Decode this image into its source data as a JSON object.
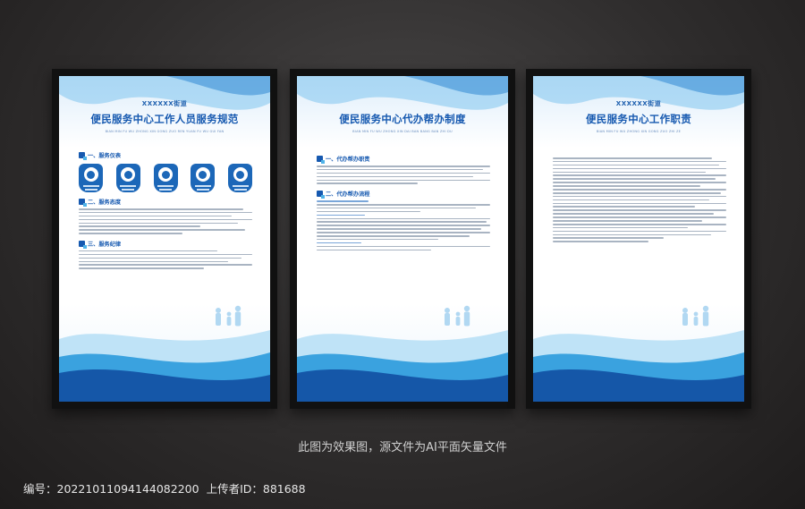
{
  "posters": [
    {
      "subtitle": "XXXXXX街道",
      "title": "便民服务中心工作人员服务规范",
      "pinyin": "BIAN MIN FU WU ZHONG XIN GONG ZUO REN YUAN FU WU GUI FAN",
      "sections": [
        "一、服务仪表",
        "二、服务态度",
        "三、服务纪律"
      ]
    },
    {
      "subtitle": "",
      "title": "便民服务中心代办帮办制度",
      "pinyin": "BIAN MIN FU WU ZHONG XIN DAI BAN BANG BAN ZHI DU",
      "sections": [
        "一、代办帮办职责",
        "二、代办帮办流程"
      ]
    },
    {
      "subtitle": "XXXXXX街道",
      "title": "便民服务中心工作职责",
      "pinyin": "BIAN MIN FU WU ZHONG XIN GONG ZUO ZHI ZE",
      "sections": []
    }
  ],
  "caption": "此图为效果图，源文件为AI平面矢量文件",
  "footer": {
    "id_label": "编号：",
    "id_value": "20221011094144082200",
    "uploader_label": "上传者ID：",
    "uploader_value": "881688"
  },
  "colors": {
    "primary": "#1659b0",
    "accent": "#4fb3e8",
    "frame": "#111111"
  }
}
